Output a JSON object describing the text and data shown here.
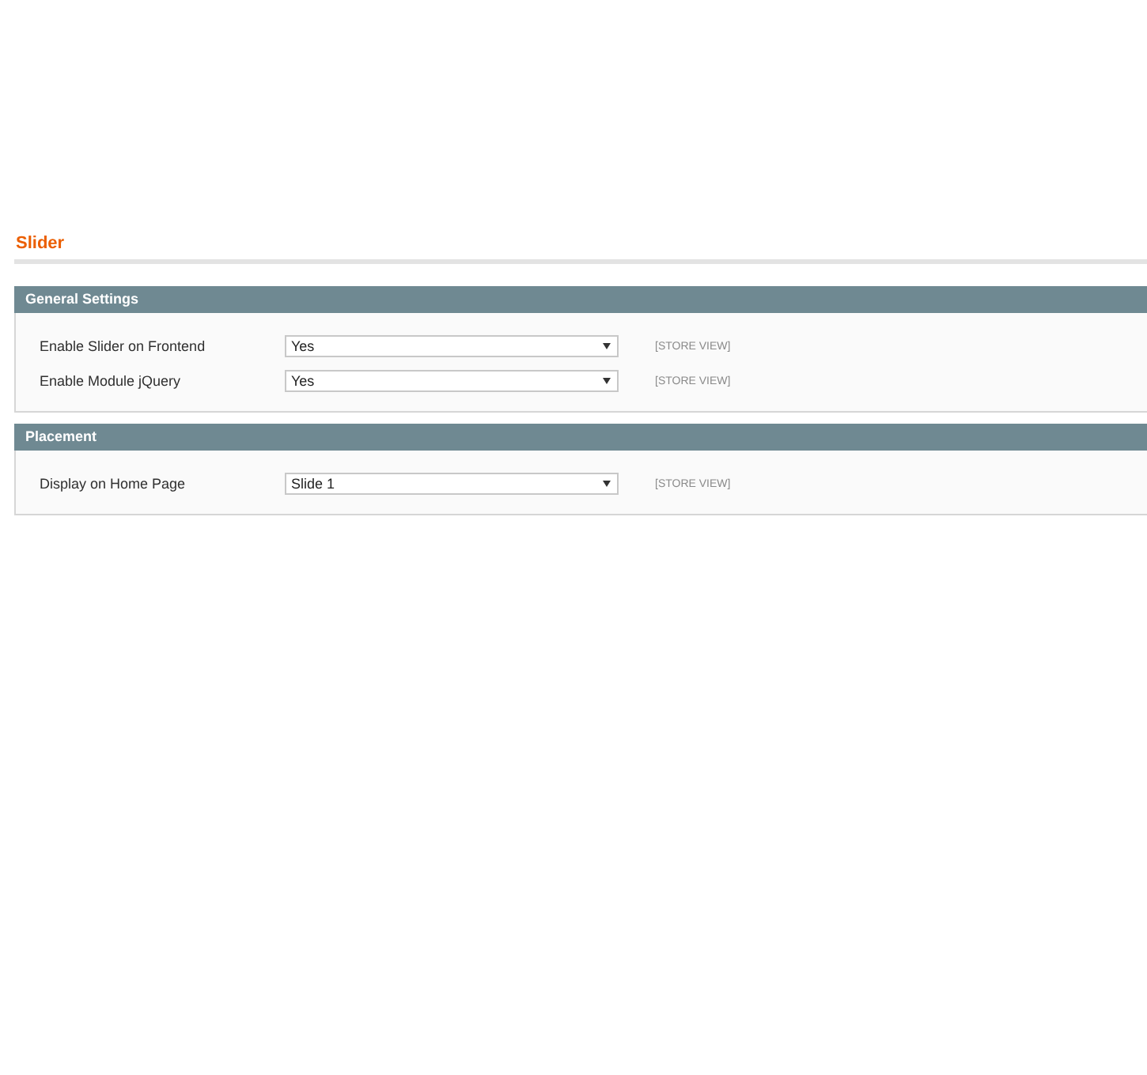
{
  "page_title": "Slider",
  "sections": [
    {
      "title": "General Settings",
      "fields": [
        {
          "label": "Enable Slider on Frontend",
          "value": "Yes",
          "scope": "[STORE VIEW]"
        },
        {
          "label": "Enable Module jQuery",
          "value": "Yes",
          "scope": "[STORE VIEW]"
        }
      ]
    },
    {
      "title": "Placement",
      "fields": [
        {
          "label": "Display on Home Page",
          "value": "Slide 1",
          "scope": "[STORE VIEW]"
        }
      ]
    }
  ]
}
